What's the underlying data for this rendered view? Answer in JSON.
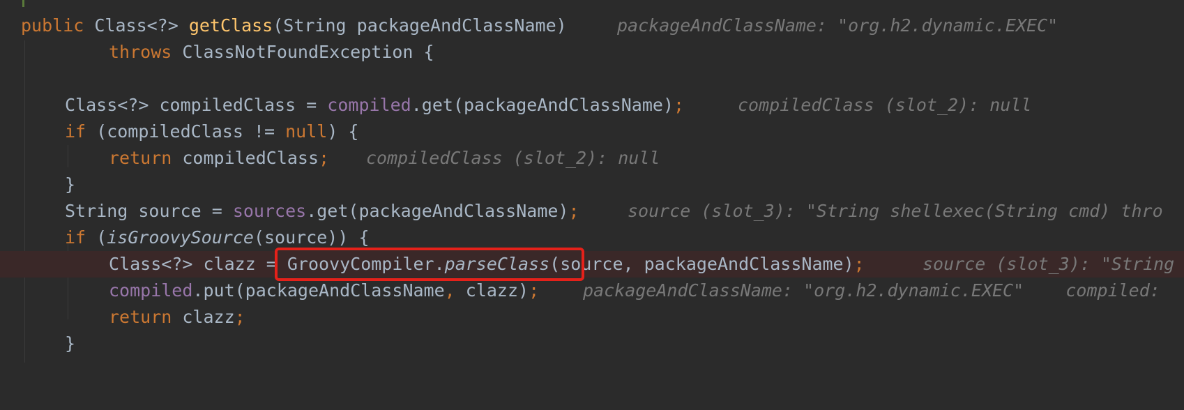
{
  "lines": [
    {
      "segments": [
        {
          "text": "public ",
          "style": "keyword"
        },
        {
          "text": "Class<?> ",
          "style": "plain"
        },
        {
          "text": "getClass",
          "style": "method"
        },
        {
          "text": "(String packageAndClassName)",
          "style": "plain"
        }
      ],
      "hint": "packageAndClassName: \"org.h2.dynamic.EXEC\""
    },
    {
      "segments": [
        {
          "text": "throws ",
          "style": "keyword"
        },
        {
          "text": "ClassNotFoundException {",
          "style": "plain"
        }
      ],
      "hint": ""
    },
    {
      "segments": [
        {
          "text": "Class<?> compiledClass = ",
          "style": "plain"
        },
        {
          "text": "compiled",
          "style": "field"
        },
        {
          "text": ".get(packageAndClassName)",
          "style": "plain"
        },
        {
          "text": ";",
          "style": "keyword"
        }
      ],
      "hint": "compiledClass (slot_2): null"
    },
    {
      "segments": [
        {
          "text": "if ",
          "style": "keyword"
        },
        {
          "text": "(compiledClass != ",
          "style": "plain"
        },
        {
          "text": "null",
          "style": "keyword"
        },
        {
          "text": ") {",
          "style": "plain"
        }
      ],
      "hint": ""
    },
    {
      "segments": [
        {
          "text": "return ",
          "style": "keyword"
        },
        {
          "text": "compiledClass",
          "style": "plain"
        },
        {
          "text": ";",
          "style": "keyword"
        }
      ],
      "hint": "compiledClass (slot_2): null"
    },
    {
      "segments": [
        {
          "text": "}",
          "style": "plain"
        }
      ],
      "hint": ""
    },
    {
      "segments": [
        {
          "text": "String source = ",
          "style": "plain"
        },
        {
          "text": "sources",
          "style": "field"
        },
        {
          "text": ".get(packageAndClassName)",
          "style": "plain"
        },
        {
          "text": ";",
          "style": "keyword"
        }
      ],
      "hint": "source (slot_3): \"String shellexec(String cmd) thro"
    },
    {
      "segments": [
        {
          "text": "if ",
          "style": "keyword"
        },
        {
          "text": "(",
          "style": "plain"
        },
        {
          "text": "isGroovySource",
          "style": "italic"
        },
        {
          "text": "(source)) {",
          "style": "plain"
        }
      ],
      "hint": ""
    },
    {
      "segments": [
        {
          "text": "Class<?> clazz = GroovyCompiler.",
          "style": "plain"
        },
        {
          "text": "parseClass",
          "style": "italic"
        },
        {
          "text": "(source, packageAndClassName)",
          "style": "plain"
        },
        {
          "text": ";",
          "style": "keyword"
        }
      ],
      "hint": "source (slot_3): \"String"
    },
    {
      "segments": [
        {
          "text": "compiled",
          "style": "field"
        },
        {
          "text": ".put(packageAndClassName",
          "style": "plain"
        },
        {
          "text": ", ",
          "style": "keyword"
        },
        {
          "text": "clazz)",
          "style": "plain"
        },
        {
          "text": ";",
          "style": "keyword"
        }
      ],
      "hint": "packageAndClassName: \"org.h2.dynamic.EXEC\"    compiled:"
    },
    {
      "segments": [
        {
          "text": "return ",
          "style": "keyword"
        },
        {
          "text": "clazz",
          "style": "plain"
        },
        {
          "text": ";",
          "style": "keyword"
        }
      ],
      "hint": ""
    },
    {
      "segments": [
        {
          "text": "}",
          "style": "plain"
        }
      ],
      "hint": ""
    }
  ],
  "colors": {
    "background": "#2b2b2b",
    "keyword": "#cc7832",
    "method": "#ffc66d",
    "field": "#9876aa",
    "plain": "#a9b7c6",
    "hint": "#787878",
    "execution_line": "#3a2828",
    "highlight_box": "#e5211a"
  }
}
